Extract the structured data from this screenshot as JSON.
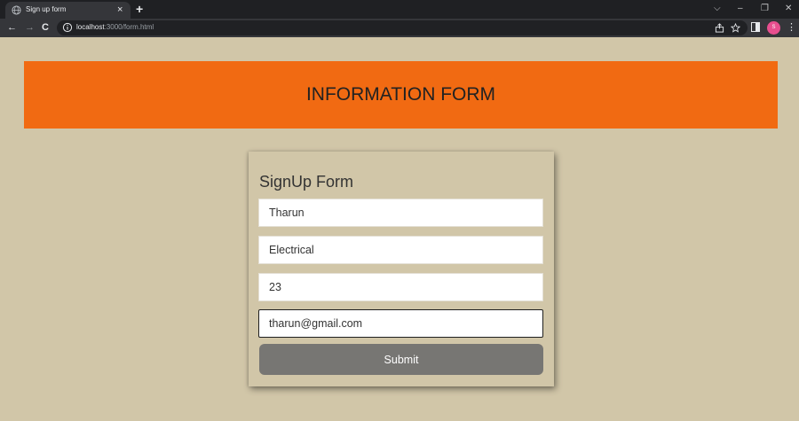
{
  "browser": {
    "tab_title": "Sign up form",
    "tab_close": "×",
    "new_tab": "+",
    "url_host": "localhost",
    "url_path": ":3000/form.html",
    "profile_initial": "S",
    "icons": [
      "globe-icon",
      "close-icon",
      "plus-icon",
      "back-arrow-icon",
      "forward-arrow-icon",
      "reload-icon",
      "info-icon",
      "share-icon",
      "star-icon",
      "side-panel-icon",
      "kebab-menu-icon"
    ]
  },
  "window_controls": {
    "dropdown": "⌵",
    "minimize": "–",
    "restore": "❐",
    "close": "✕"
  },
  "nav": {
    "back": "←",
    "forward": "→",
    "reload": "C"
  },
  "page": {
    "banner_title": "INFORMATION FORM",
    "banner_color": "#f16a12",
    "background_color": "#d1c6a8"
  },
  "form": {
    "title": "SignUp Form",
    "fields": [
      {
        "value": "Tharun"
      },
      {
        "value": "Electrical"
      },
      {
        "value": "23"
      },
      {
        "value": "tharun@gmail.com"
      }
    ],
    "submit_label": "Submit"
  },
  "kebab": "⋮"
}
